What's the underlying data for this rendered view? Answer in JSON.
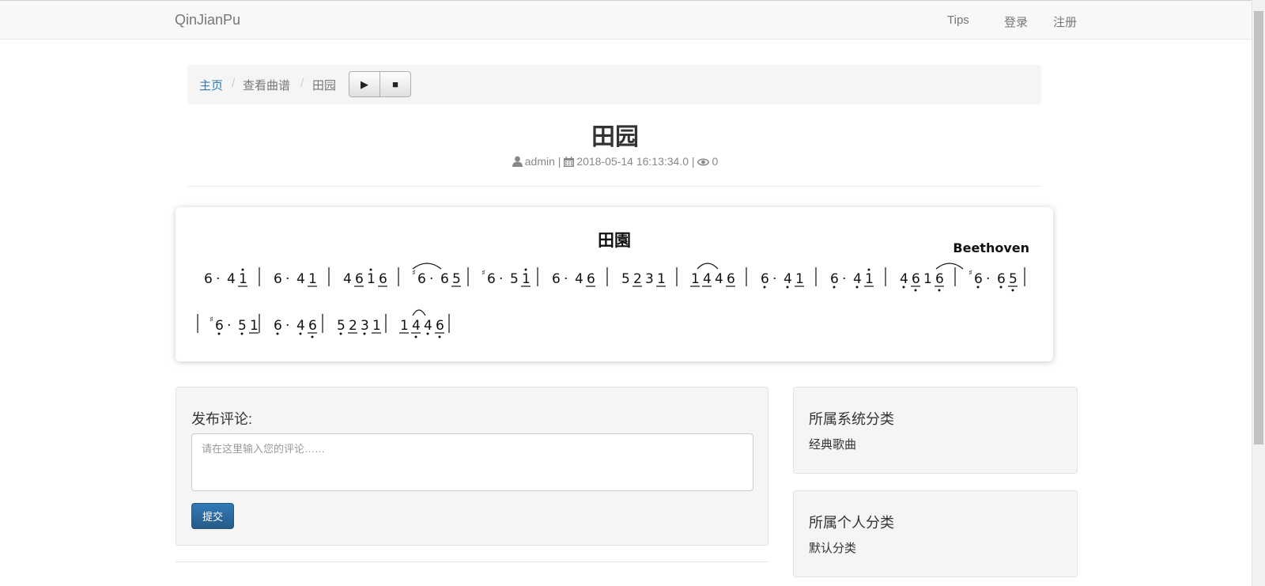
{
  "navbar": {
    "brand": "QinJianPu",
    "tips": "Tips",
    "login": "登录",
    "register": "注册"
  },
  "breadcrumb": {
    "home": "主页",
    "view": "查看曲谱",
    "current": "田园",
    "play_glyph": "▶",
    "stop_glyph": "■"
  },
  "song": {
    "title": "田园",
    "author": "admin",
    "date": "2018-05-14 16:13:34.0",
    "views": "0",
    "sep": "|"
  },
  "score": {
    "title": "田園",
    "composer": "Beethoven",
    "rows": [
      [
        [
          [
            "6",
            0,
            0
          ],
          [
            "·",
            0,
            0
          ],
          [
            "4",
            0,
            0
          ],
          [
            "1",
            1,
            1
          ]
        ],
        [
          [
            "6",
            0,
            0
          ],
          [
            "·",
            0,
            0
          ],
          [
            "4",
            0,
            0
          ],
          [
            "1",
            0,
            1
          ]
        ],
        [
          [
            "4",
            0,
            0
          ],
          [
            "6",
            0,
            1
          ],
          [
            "1",
            1,
            0
          ],
          [
            "6",
            0,
            1
          ]
        ],
        [
          [
            "#6",
            0,
            0
          ],
          [
            "·",
            0,
            0
          ],
          [
            "6",
            0,
            0
          ],
          [
            "5",
            0,
            1
          ]
        ],
        [
          [
            "#6",
            0,
            0
          ],
          [
            "·",
            0,
            0
          ],
          [
            "5",
            0,
            0
          ],
          [
            "1",
            1,
            1
          ]
        ],
        [
          [
            "6",
            0,
            0
          ],
          [
            "·",
            0,
            0
          ],
          [
            "4",
            0,
            0
          ],
          [
            "6",
            0,
            1
          ]
        ],
        [
          [
            "5",
            0,
            0
          ],
          [
            "2",
            0,
            1
          ],
          [
            "3",
            0,
            0
          ],
          [
            "1",
            0,
            1
          ]
        ],
        [
          [
            "1",
            0,
            1
          ],
          [
            "4",
            0,
            1
          ],
          [
            "4",
            0,
            0
          ],
          [
            "6",
            0,
            1
          ]
        ],
        [
          [
            "6",
            -1,
            0
          ],
          [
            "·",
            0,
            0
          ],
          [
            "4",
            -1,
            0
          ],
          [
            "1",
            0,
            1
          ]
        ],
        [
          [
            "6",
            -1,
            0
          ],
          [
            "·",
            0,
            0
          ],
          [
            "4",
            -1,
            0
          ],
          [
            "1",
            1,
            1
          ]
        ],
        [
          [
            "4",
            -1,
            0
          ],
          [
            "6",
            -1,
            1
          ],
          [
            "1",
            0,
            0
          ],
          [
            "6",
            -1,
            1
          ]
        ],
        [
          [
            "#6",
            -1,
            0
          ],
          [
            "·",
            0,
            0
          ],
          [
            "6",
            -1,
            0
          ],
          [
            "5",
            -1,
            1
          ]
        ]
      ],
      [
        [
          [
            "#6",
            -1,
            0
          ],
          [
            "·",
            0,
            0
          ],
          [
            "5",
            -1,
            0
          ],
          [
            "1",
            0,
            1
          ]
        ],
        [
          [
            "6",
            -1,
            0
          ],
          [
            "·",
            0,
            0
          ],
          [
            "4",
            -1,
            0
          ],
          [
            "6",
            -1,
            1
          ]
        ],
        [
          [
            "5",
            -1,
            0
          ],
          [
            "2",
            0,
            1
          ],
          [
            "3",
            -1,
            0
          ],
          [
            "1",
            0,
            1
          ]
        ],
        [
          [
            "1",
            0,
            1
          ],
          [
            "4",
            -1,
            1
          ],
          [
            "4",
            -1,
            0
          ],
          [
            "6",
            -1,
            1
          ]
        ]
      ]
    ]
  },
  "comment": {
    "label": "发布评论:",
    "placeholder": "请在这里输入您的评论……",
    "submit": "提交"
  },
  "sidebar": {
    "system_category": {
      "heading": "所属系统分类",
      "value": "经典歌曲"
    },
    "personal_category": {
      "heading": "所属个人分类",
      "value": "默认分类"
    }
  },
  "colors": {
    "link": "#337ab7",
    "primary": "#2e6da4",
    "navbar_bg": "#f8f8f8",
    "panel_bg": "#f5f5f5"
  }
}
